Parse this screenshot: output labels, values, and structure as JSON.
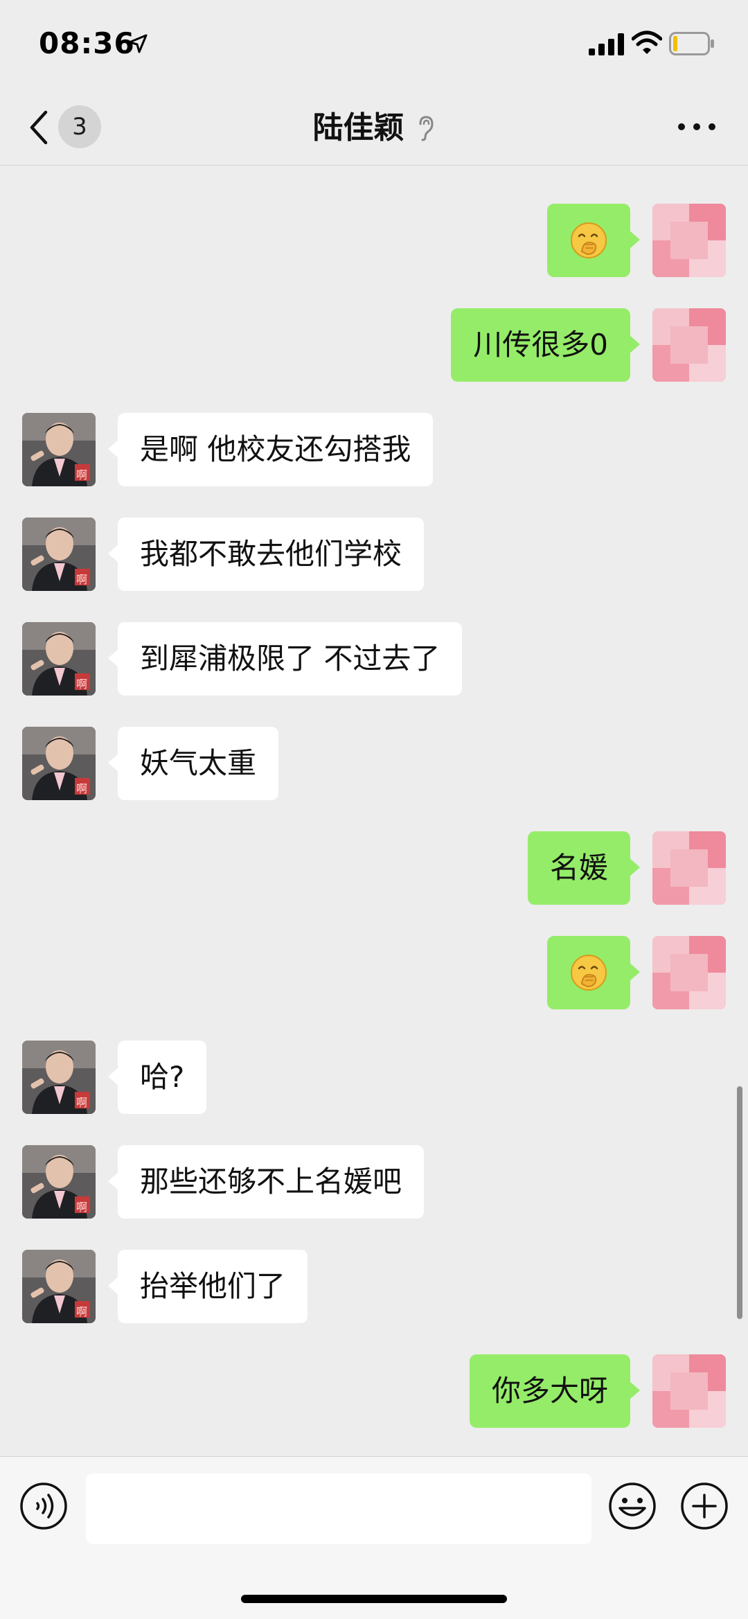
{
  "status_bar": {
    "time": "08:36"
  },
  "nav": {
    "unread_count": "3",
    "title": "陆佳颖"
  },
  "messages": [
    {
      "side": "right",
      "type": "emoji",
      "emoji": "hand-over-mouth-face"
    },
    {
      "side": "right",
      "type": "text",
      "text": "川传很多0"
    },
    {
      "side": "left",
      "type": "text",
      "text": "是啊 他校友还勾搭我"
    },
    {
      "side": "left",
      "type": "text",
      "text": "我都不敢去他们学校"
    },
    {
      "side": "left",
      "type": "text",
      "text": "到犀浦极限了 不过去了"
    },
    {
      "side": "left",
      "type": "text",
      "text": "妖气太重"
    },
    {
      "side": "right",
      "type": "text",
      "text": "名媛"
    },
    {
      "side": "right",
      "type": "emoji",
      "emoji": "hand-over-mouth-face"
    },
    {
      "side": "left",
      "type": "text",
      "text": "哈?"
    },
    {
      "side": "left",
      "type": "text",
      "text": "那些还够不上名媛吧"
    },
    {
      "side": "left",
      "type": "text",
      "text": "抬举他们了"
    },
    {
      "side": "right",
      "type": "text",
      "text": "你多大呀"
    }
  ],
  "avatar_badge_text": "啊",
  "input": {
    "value": "",
    "placeholder": ""
  },
  "colors": {
    "background": "#ededed",
    "sent_bubble": "#95ec69",
    "received_bubble": "#ffffff"
  }
}
